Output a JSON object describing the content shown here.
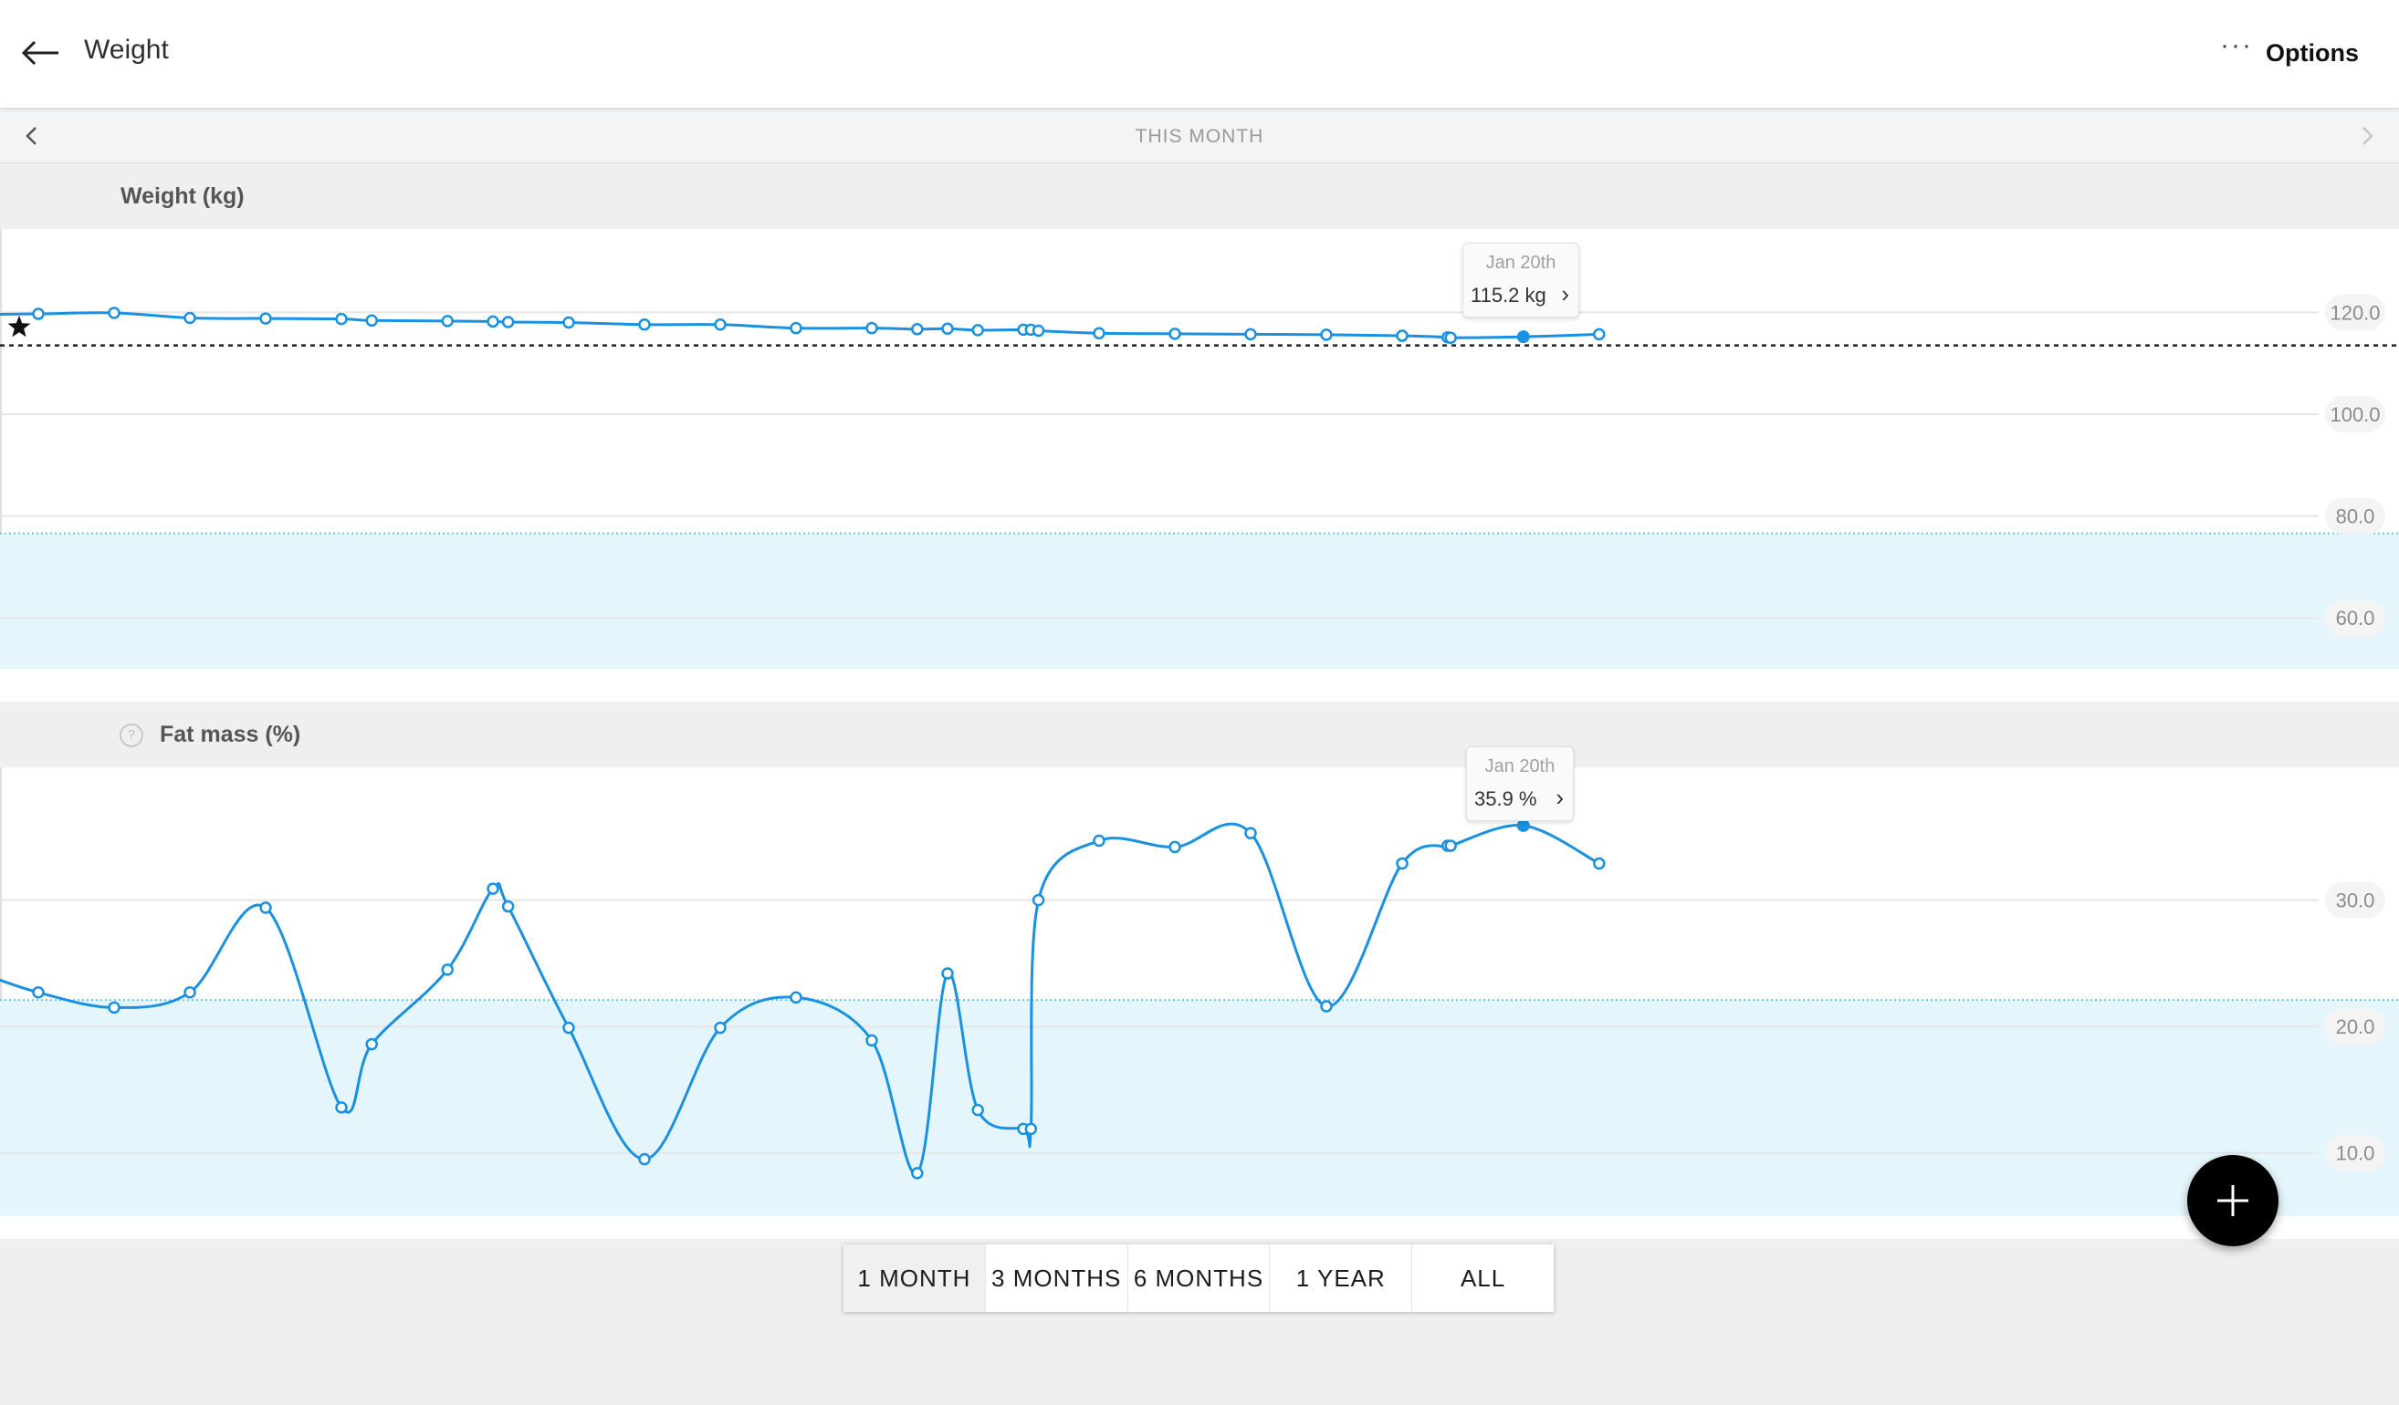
{
  "header": {
    "title": "Weight",
    "options_label": "Options"
  },
  "period": {
    "label": "THIS MONTH"
  },
  "colors": {
    "line": "#1a91e0",
    "target_band": "#e4f6fc"
  },
  "weight_chart": {
    "title": "Weight (kg)",
    "y_ticks": [
      "120.0",
      "100.0",
      "80.0",
      "60.0"
    ],
    "tooltip": {
      "date": "Jan 20th",
      "value": "115.2 kg"
    }
  },
  "fat_chart": {
    "title": "Fat mass (%)",
    "y_ticks": [
      "30.0",
      "20.0",
      "10.0"
    ],
    "tooltip": {
      "date": "Jan 20th",
      "value": "35.9 %"
    }
  },
  "chart_data": [
    {
      "type": "line",
      "title": "Weight (kg)",
      "ylim": [
        50,
        131
      ],
      "ticks": [
        120,
        100,
        80,
        60
      ],
      "goal": 113.5,
      "healthy_band_top": 76.6,
      "x": [
        0,
        0.5,
        1.0,
        1.5,
        2.0,
        2.2,
        2.7,
        3.0,
        3.1,
        3.5,
        4.0,
        4.5,
        5.0,
        5.5,
        5.8,
        6.0,
        6.2,
        6.5,
        6.55,
        6.6,
        7.0,
        7.5,
        8.0,
        8.5,
        9.0,
        9.3,
        9.32,
        9.8,
        10.3
      ],
      "y": [
        119.7,
        119.9,
        118.9,
        118.8,
        118.7,
        118.4,
        118.3,
        118.2,
        118.1,
        118.0,
        117.6,
        117.6,
        116.9,
        116.9,
        116.7,
        116.8,
        116.5,
        116.6,
        116.6,
        116.4,
        115.9,
        115.8,
        115.7,
        115.6,
        115.4,
        115.1,
        115.0,
        115.2,
        115.7
      ],
      "selected_index": 27
    },
    {
      "type": "line",
      "title": "Fat mass (%)",
      "ylim": [
        5,
        39.5
      ],
      "ticks": [
        30,
        20,
        10
      ],
      "healthy_band_top": 22.1,
      "x": [
        0,
        0.5,
        1.0,
        1.5,
        2.0,
        2.2,
        2.7,
        3.0,
        3.1,
        3.5,
        4.0,
        4.5,
        5.0,
        5.5,
        5.8,
        6.0,
        6.2,
        6.5,
        6.55,
        6.6,
        7.0,
        7.5,
        8.0,
        8.5,
        9.0,
        9.3,
        9.32,
        9.8,
        10.3
      ],
      "y": [
        22.7,
        21.5,
        22.7,
        29.4,
        13.6,
        18.6,
        24.5,
        30.9,
        29.5,
        19.9,
        9.5,
        19.9,
        22.3,
        18.9,
        8.4,
        24.2,
        13.4,
        11.9,
        11.9,
        30.0,
        34.7,
        34.2,
        35.3,
        21.6,
        32.9,
        34.3,
        34.3,
        35.9,
        32.9
      ],
      "selected_index": 27
    }
  ],
  "ranges": [
    "1 MONTH",
    "3 MONTHS",
    "6 MONTHS",
    "1 YEAR",
    "ALL"
  ],
  "active_range": "1 MONTH",
  "icons": {
    "back": "arrow-left-icon",
    "options": "more-horizontal-icon",
    "prev": "chevron-left-icon",
    "next": "chevron-right-icon",
    "goal": "star-icon",
    "help": "question-circle-icon",
    "add": "plus-icon"
  }
}
